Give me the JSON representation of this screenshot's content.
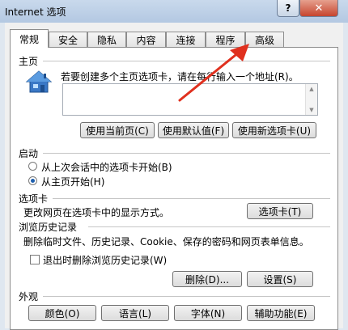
{
  "window": {
    "title": "Internet 选项",
    "help_label": "?",
    "close_label": "✕"
  },
  "tabs": [
    {
      "label": "常规",
      "active": true
    },
    {
      "label": "安全"
    },
    {
      "label": "隐私"
    },
    {
      "label": "内容"
    },
    {
      "label": "连接"
    },
    {
      "label": "程序"
    },
    {
      "label": "高级"
    }
  ],
  "home": {
    "title": "主页",
    "desc": "若要创建多个主页选项卡，请在每行输入一个地址(R)。",
    "addresses": "",
    "buttons": {
      "current": "使用当前页(C)",
      "default": "使用默认值(F)",
      "new_tab": "使用新选项卡(U)"
    },
    "icon": "house-icon"
  },
  "startup": {
    "title": "启动",
    "option_last": "从上次会话中的选项卡开始(B)",
    "option_home": "从主页开始(H)",
    "selected": "option_home"
  },
  "tabs_section": {
    "title": "选项卡",
    "desc": "更改网页在选项卡中的显示方式。",
    "button": "选项卡(T)"
  },
  "history": {
    "title": "浏览历史记录",
    "desc": "删除临时文件、历史记录、Cookie、保存的密码和网页表单信息。",
    "checkbox_label": "退出时删除浏览历史记录(W)",
    "checked": false,
    "delete_button": "删除(D)...",
    "settings_button": "设置(S)"
  },
  "appearance": {
    "title": "外观",
    "colors": "颜色(O)",
    "languages": "语言(L)",
    "fonts": "字体(N)",
    "accessibility": "辅助功能(E)"
  },
  "annotation": {
    "color": "#e0301e"
  }
}
